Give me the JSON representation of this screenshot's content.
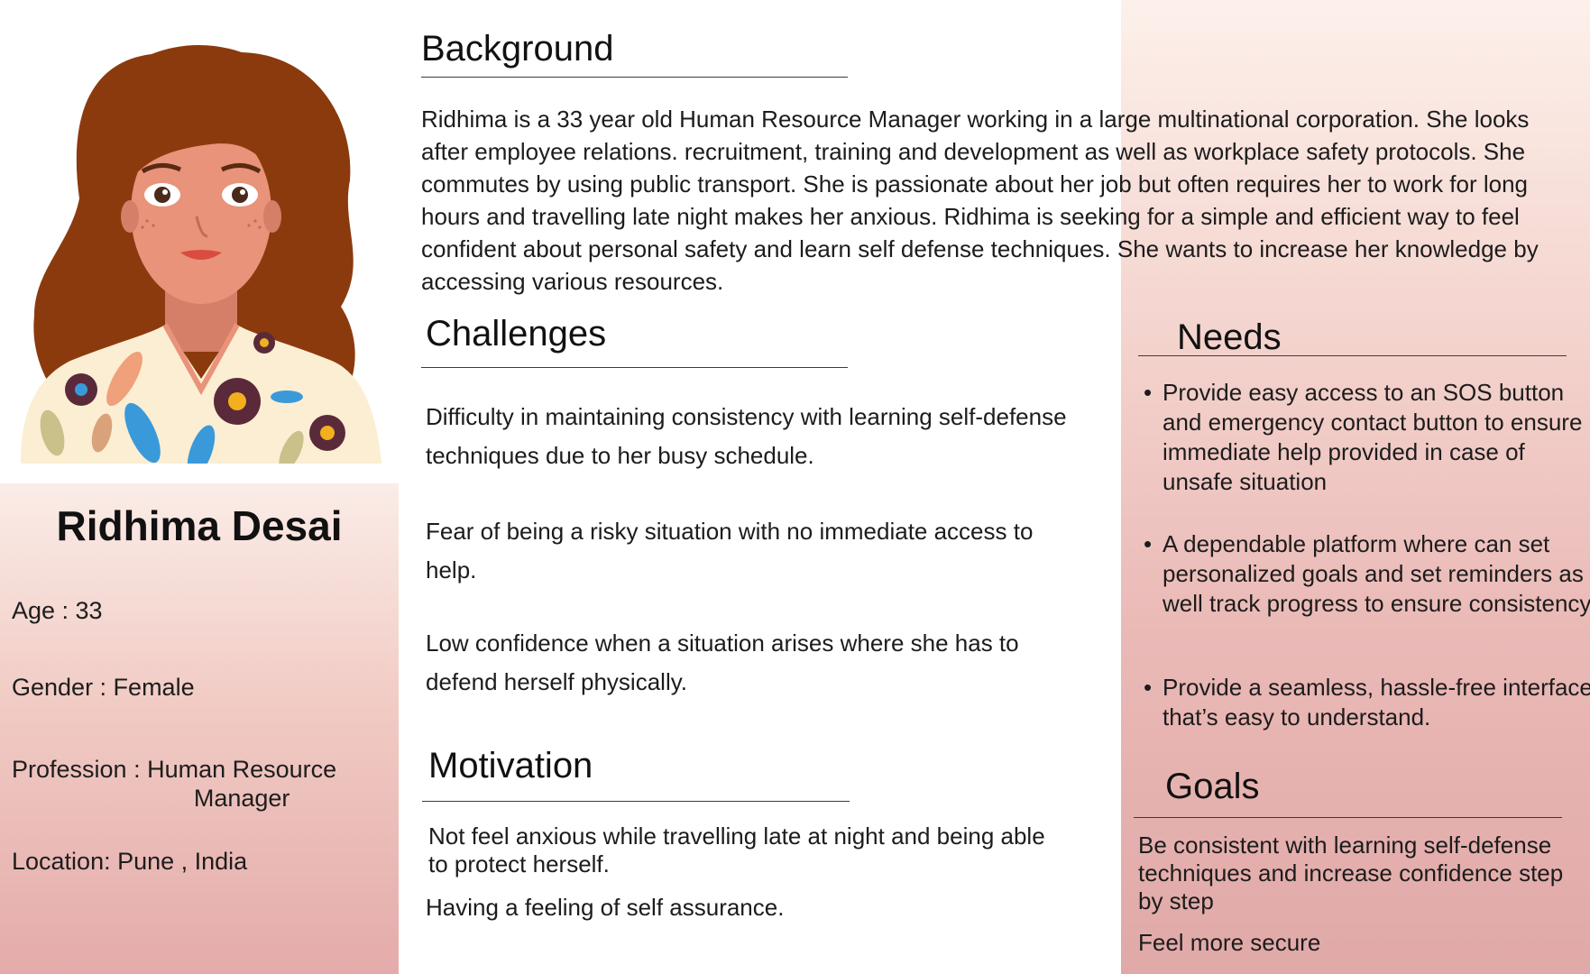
{
  "persona": {
    "name": "Ridhima Desai",
    "age_label": "Age : 33",
    "gender_label": "Gender : Female",
    "profession_label": "Profession : ",
    "profession_value_line1": "Human Resource",
    "profession_value_line2": "Manager",
    "location_label": "Location: Pune , India"
  },
  "background": {
    "title": "Background",
    "text": "Ridhima is a 33 year old Human Resource Manager working in a large multinational corporation. She looks after employee relations. recruitment, training and development as well as workplace safety protocols. She commutes by using public transport.  She is passionate about her job but often requires her to work for long hours  and  travelling late night makes her anxious. Ridhima is seeking for a simple and efficient way to feel confident about personal safety and learn self defense techniques. She wants to increase her knowledge by accessing various resources."
  },
  "challenges": {
    "title": "Challenges",
    "items": [
      "Difficulty in maintaining consistency with learning self-defense techniques due to her busy schedule.",
      "Fear of being a risky situation with no immediate access to help.",
      "Low confidence when a situation arises where she has to defend herself physically."
    ]
  },
  "motivation": {
    "title": "Motivation",
    "items": [
      "Not feel anxious while travelling late at night and being able to protect herself.",
      "Having a feeling of self assurance."
    ]
  },
  "needs": {
    "title": "Needs",
    "bullet": "•",
    "items": [
      "Provide easy access to an SOS button and emergency contact button to ensure immediate help provided in case of unsafe situation",
      "A dependable platform where can set personalized goals and set reminders as well track progress to ensure consistency",
      "Provide a seamless, hassle-free interface that’s easy to understand."
    ]
  },
  "goals": {
    "title": "Goals",
    "items": [
      "Be consistent with learning self-defense techniques and increase confidence step by step",
      "Feel more secure"
    ]
  },
  "colors": {
    "hair": "#8b3a0e",
    "skin": "#e8937a",
    "shirt": "#fbeed3",
    "flower_dark": "#5b2a3a",
    "leaf_blue": "#3a9ad9",
    "panel_pink": "#e4abaa"
  },
  "icons": {
    "avatar": "woman-avatar-illustration"
  }
}
